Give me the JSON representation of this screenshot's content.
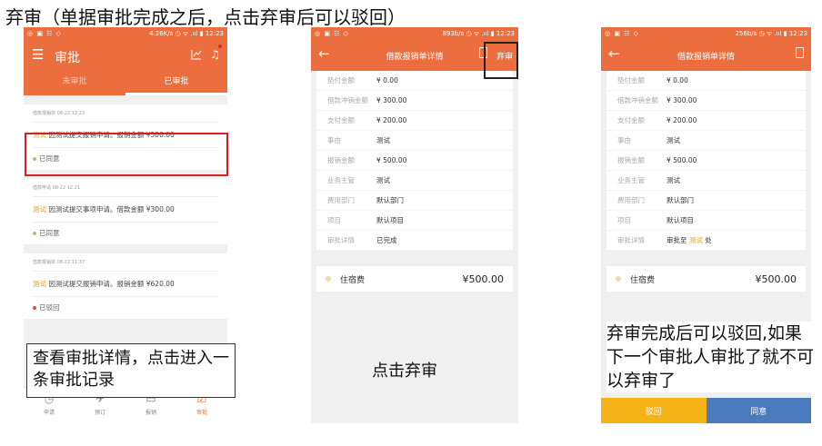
{
  "page_title": "弃审（单据审批完成之后，点击弃审后可以驳回）",
  "statusbar": {
    "p1": {
      "left": "◎ ▣ ☷ ◇",
      "right": "4.26K/s ◷ ᯤ .ııl ▮ 12:23"
    },
    "p2": {
      "left": "◎ ▣ ☷ ◇",
      "right": "893b/s ◷ ᯤ .ııl ▮ 12:23"
    },
    "p3": {
      "left": "◎ ▣ ☷ ◇",
      "right": "256b/s ◷ ᯤ .ııl ▮ 12:23"
    }
  },
  "phone1": {
    "title": "审批",
    "tabs": [
      "未审批",
      "已审批"
    ],
    "cards": [
      {
        "meta": "借款报销单 08-22 12:23",
        "tag": "测试",
        "text": " 因测试提交报销申请。报销金额 ¥500.00",
        "status": "已同意",
        "status_color": "#a8c67a"
      },
      {
        "meta": "借款申请 08-22 12:21",
        "tag": "测试",
        "text": " 因测试提交事项申请。借款金额 ¥300.00",
        "status": "已同意",
        "status_color": "#a8c67a"
      },
      {
        "meta": "借款报销单 08-22 11:37",
        "tag": "测试",
        "text": " 因测试提交报销申请。报销金额 ¥620.00",
        "status": "已驳回",
        "status_color": "#e84a3a"
      }
    ],
    "nav": [
      "申请",
      "预订",
      "报销",
      "审批"
    ]
  },
  "phone2": {
    "title": "借款报销单详情",
    "abandon": "弃审",
    "rows": [
      {
        "label": "垫付金额",
        "value": "¥ 0.00"
      },
      {
        "label": "借款冲销金额",
        "value": "¥ 300.00"
      },
      {
        "label": "支付金额",
        "value": "¥ 200.00"
      },
      {
        "label": "事由",
        "value": "测试"
      },
      {
        "label": "报销金额",
        "value": "¥ 500.00"
      },
      {
        "label": "业务主管",
        "value": "测试"
      },
      {
        "label": "费用部门",
        "value": "默认部门"
      },
      {
        "label": "项目",
        "value": "默认项目"
      },
      {
        "label": "审批详情",
        "value": "已完成"
      }
    ],
    "item_name": "住宿费",
    "item_amount": "¥500.00"
  },
  "phone3": {
    "title": "借款报销单详情",
    "rows": [
      {
        "label": "垫付金额",
        "value": "¥ 0.00"
      },
      {
        "label": "借款冲销金额",
        "value": "¥ 300.00"
      },
      {
        "label": "支付金额",
        "value": "¥ 200.00"
      },
      {
        "label": "事由",
        "value": "测试"
      },
      {
        "label": "报销金额",
        "value": "¥ 500.00"
      },
      {
        "label": "业务主管",
        "value": "测试"
      },
      {
        "label": "费用部门",
        "value": "默认部门"
      },
      {
        "label": "项目",
        "value": "默认项目"
      }
    ],
    "approval_label": "审批详情",
    "approval_prefix": "审批至 ",
    "approval_name": "测试",
    "approval_suffix": " 处",
    "item_name": "住宿费",
    "item_amount": "¥500.00",
    "reject_label": "驳回",
    "agree_label": "同意"
  },
  "annotations": {
    "ann1": "查看审批详情，点击进入一条审批记录",
    "ann2": "点击弃审",
    "ann3": "弃审完成后可以驳回,如果下一个审批人审批了就不可以弃审了"
  },
  "colors": {
    "brand": "#ec6e3e",
    "tag": "#e8a020",
    "reject": "#f5b317",
    "agree": "#4b7bbf",
    "highlight_red": "#d42020"
  }
}
